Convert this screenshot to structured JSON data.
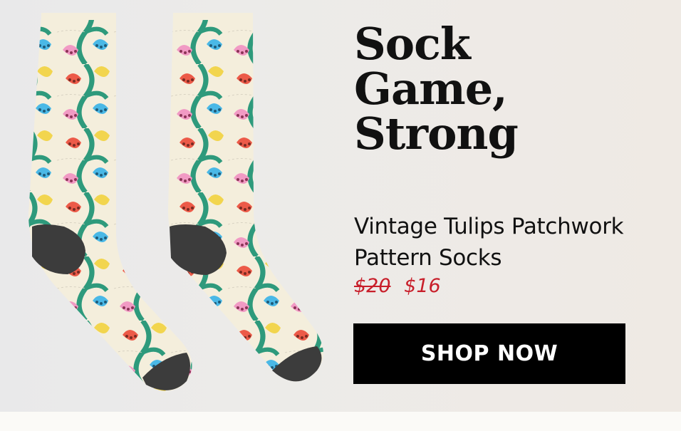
{
  "hero": {
    "headline_lines": [
      "Sock",
      "Game,",
      "Strong"
    ],
    "product_name": "Vintage Tulips Patchwork Pattern Socks",
    "price_original": "$20",
    "price_sale": "$16",
    "cta_label": "SHOP NOW"
  },
  "image": {
    "alt": "Pair of socks with vintage tulip patchwork pattern"
  },
  "colors": {
    "cta_background": "#000000",
    "sale_price": "#c81e2a",
    "sock_base": "#f4eedc",
    "stem_green": "#2e9a7c",
    "tulip_red": "#ec5a48",
    "tulip_yellow": "#f2d54e",
    "tulip_blue": "#4ab8e6",
    "tulip_pink": "#f19ac4",
    "heel_toe": "#3c3c3c"
  }
}
